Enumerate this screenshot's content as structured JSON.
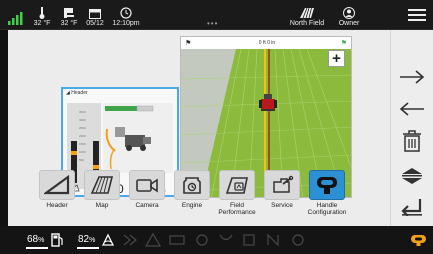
{
  "status_bar": {
    "outside_temp": "32 °F",
    "cab_temp": "32 °F",
    "date": "05/12",
    "time": "12:10pm",
    "field_name": "North Field",
    "user": "Owner"
  },
  "map": {
    "header_text": "0 ft 0 in"
  },
  "header_popup": {
    "title": "Header",
    "value": "2200"
  },
  "nav_items": [
    {
      "label": "Header"
    },
    {
      "label": "Map"
    },
    {
      "label": "Camera"
    },
    {
      "label": "Engine"
    },
    {
      "label": "Field\nPerformance"
    },
    {
      "label": "Service"
    },
    {
      "label": "Handle\nConfiguration"
    }
  ],
  "bottom_bar": {
    "fuel_pct": "68",
    "def_pct": "82",
    "unit": "%"
  },
  "colors": {
    "accent": "#2d8fd4",
    "signal_green": "#3fd14a",
    "warning_orange": "#f3a11b",
    "field_green": "#8fbc3f"
  }
}
